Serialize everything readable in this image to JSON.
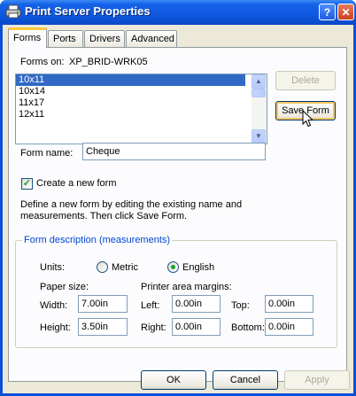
{
  "window": {
    "title": "Print Server Properties",
    "help_glyph": "?",
    "close_glyph": "✕"
  },
  "tabs": [
    {
      "label": "Forms"
    },
    {
      "label": "Ports"
    },
    {
      "label": "Drivers"
    },
    {
      "label": "Advanced"
    }
  ],
  "forms": {
    "forms_on_label": "Forms on:",
    "server_name": "XP_BRID-WRK05",
    "list_items": [
      "10x11",
      "10x14",
      "11x17",
      "12x11"
    ],
    "selected_item": "10x11",
    "delete_label": "Delete",
    "save_form_label": "Save Form",
    "form_name_label": "Form name:",
    "form_name_value": "Cheque",
    "create_new_label": "Create a new form",
    "create_new_checked": true,
    "description_line1": "Define a new form by editing the existing name and",
    "description_line2": "measurements.  Then click Save Form."
  },
  "group": {
    "title": "Form description (measurements)",
    "units_label": "Units:",
    "metric_label": "Metric",
    "english_label": "English",
    "selected_unit": "English",
    "paper_size_label": "Paper size:",
    "margins_label": "Printer area margins:",
    "width_label": "Width:",
    "width_value": "7.00in",
    "height_label": "Height:",
    "height_value": "3.50in",
    "left_label": "Left:",
    "left_value": "0.00in",
    "right_label": "Right:",
    "right_value": "0.00in",
    "top_label": "Top:",
    "top_value": "0.00in",
    "bottom_label": "Bottom:",
    "bottom_value": "0.00in"
  },
  "footer": {
    "ok_label": "OK",
    "cancel_label": "Cancel",
    "apply_label": "Apply"
  }
}
